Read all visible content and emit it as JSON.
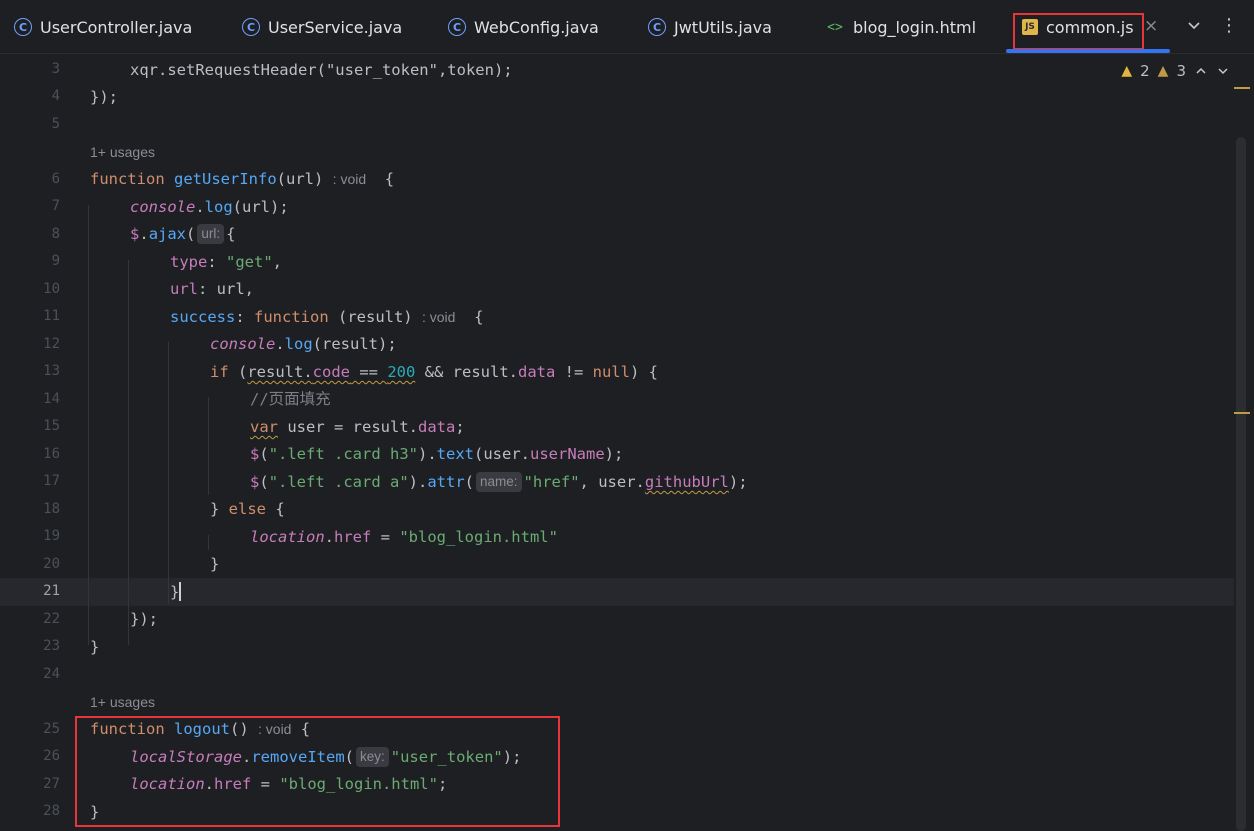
{
  "tabs": [
    {
      "label": "UserController.java",
      "icon": "java-class-icon"
    },
    {
      "label": "UserService.java",
      "icon": "java-class-icon"
    },
    {
      "label": "WebConfig.java",
      "icon": "java-class-icon"
    },
    {
      "label": "JwtUtils.java",
      "icon": "java-class-icon"
    },
    {
      "label": "blog_login.html",
      "icon": "html-file-icon"
    },
    {
      "label": "common.js",
      "icon": "js-file-icon",
      "active": true
    }
  ],
  "icons": {
    "java_glyph": "C",
    "html_glyph": "<>",
    "js_glyph": "JS",
    "close": "×",
    "menu": "⋮"
  },
  "inspections": {
    "warnings": "2",
    "weak_warnings": "3"
  },
  "usages_label": "1+ usages",
  "type_hint": ": void",
  "param_hints": {
    "url": "url:",
    "name": "name:",
    "key": "key:"
  },
  "line_numbers": [
    "3",
    "4",
    "5",
    "6",
    "7",
    "8",
    "9",
    "10",
    "11",
    "12",
    "13",
    "14",
    "15",
    "16",
    "17",
    "18",
    "19",
    "20",
    "21",
    "22",
    "23",
    "24",
    "25",
    "26",
    "27",
    "28"
  ],
  "code": {
    "l3": "xqr.setRequestHeader(\"user_token\",token);",
    "l4": "});",
    "l6_fn": "function",
    "l6_name": "getUserInfo",
    "l6_args": "(url)",
    "l7": "console.log(url);",
    "l8": "$.ajax(",
    "l9": "type: \"get\",",
    "l10": "url: url,",
    "l11": "success: function (result)",
    "l12": "console.log(result);",
    "l13": "if (result.code == 200 && result.data != null) {",
    "l14": "//页面填充",
    "l15": "var user = result.data;",
    "l16": "$(\".left .card h3\").text(user.userName);",
    "l17": "$(\".left .card a\").attr(",
    "l18": "} else {",
    "l19": "location.href = \"blog_login.html\"",
    "l20": "}",
    "l21": "}",
    "l22": "});",
    "l23": "}",
    "l25": "function logout()",
    "l26": "localStorage.removeItem(",
    "l27": "location.href = \"blog_login.html\";",
    "l28": "}"
  }
}
